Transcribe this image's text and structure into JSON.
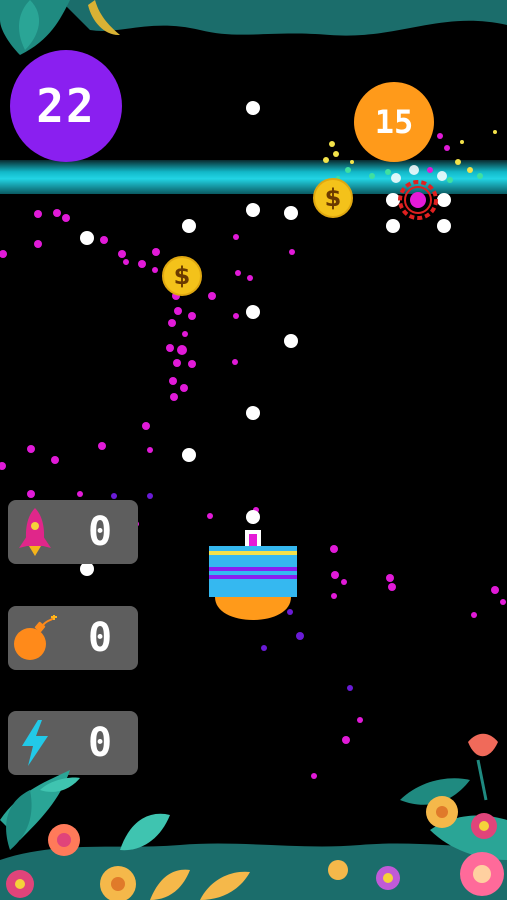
{
  "hud": {
    "score": "22",
    "target_count": "15"
  },
  "coins": [
    {
      "symbol": "$"
    },
    {
      "symbol": "$"
    }
  ],
  "powerups": [
    {
      "name": "rocket-icon",
      "count": "0"
    },
    {
      "name": "bomb-icon",
      "count": "0"
    },
    {
      "name": "lightning-icon",
      "count": "0"
    }
  ],
  "colors": {
    "score_circle": "#8a1ff0",
    "target_circle": "#ff9a1a",
    "barrier": "#22d4e4",
    "coin": "#f4c21a",
    "cannon_stripe_blue": "#35b8f0",
    "cannon_stripe_purple": "#8a1ff0",
    "cannon_base": "#ff9a1a"
  }
}
